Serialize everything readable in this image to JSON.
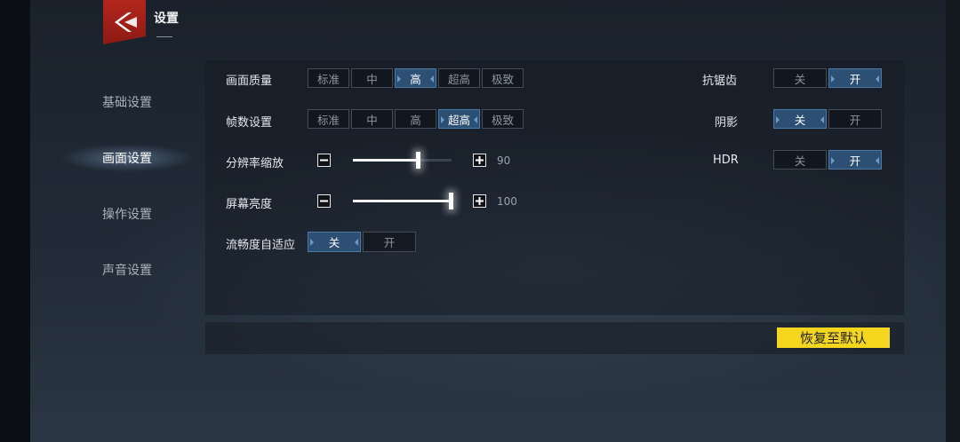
{
  "header": {
    "title": "设置",
    "back_icon": "chevron-left-icon",
    "brand_color": "#b3261e"
  },
  "sidebar": {
    "items": [
      {
        "label": "基础设置",
        "active": false
      },
      {
        "label": "画面设置",
        "active": true
      },
      {
        "label": "操作设置",
        "active": false
      },
      {
        "label": "声音设置",
        "active": false
      }
    ]
  },
  "settings": {
    "quality": {
      "label": "画面质量",
      "options": [
        "标准",
        "中",
        "高",
        "超高",
        "极致"
      ],
      "selected": "高"
    },
    "framerate": {
      "label": "帧数设置",
      "options": [
        "标准",
        "中",
        "高",
        "超高",
        "极致"
      ],
      "selected": "超高"
    },
    "resolution": {
      "label": "分辨率缩放",
      "value": "90",
      "level": 0.66,
      "minus_icon": "minus-icon",
      "plus_icon": "plus-icon"
    },
    "brightness": {
      "label": "屏幕亮度",
      "value": "100",
      "level": 0.99,
      "minus_icon": "minus-icon",
      "plus_icon": "plus-icon"
    },
    "adaptive": {
      "label": "流畅度自适应",
      "options": [
        "关",
        "开"
      ],
      "selected": "关"
    },
    "antialias": {
      "label": "抗锯齿",
      "options": [
        "关",
        "开"
      ],
      "selected": "开"
    },
    "shadow": {
      "label": "阴影",
      "options": [
        "关",
        "开"
      ],
      "selected": "关"
    },
    "hdr": {
      "label": "HDR",
      "options": [
        "关",
        "开"
      ],
      "selected": "开"
    }
  },
  "footer": {
    "reset_label": "恢复至默认",
    "reset_color": "#f4d61e"
  },
  "colors": {
    "selected_option": "#2d4f73",
    "panel_bg": "#161c24"
  }
}
